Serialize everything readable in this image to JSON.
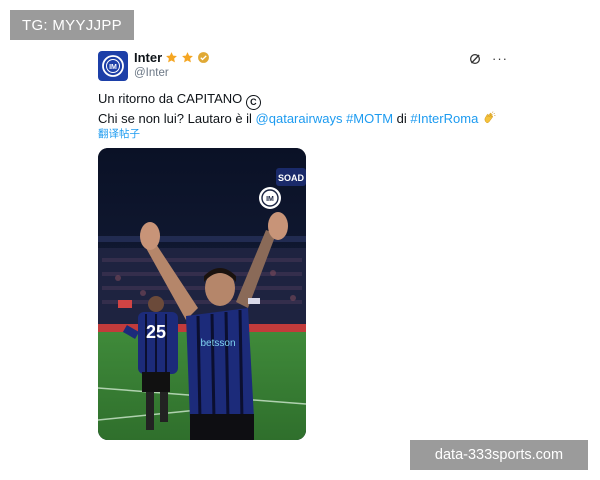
{
  "watermarks": {
    "top_left": "TG: MYYJJPP",
    "bottom_right": "data-333sports.com"
  },
  "tweet": {
    "author": {
      "name": "Inter",
      "handle": "@Inter",
      "avatar_icon": "inter-logo-icon",
      "badges": [
        "star-icon",
        "star-icon",
        "verified-badge-icon"
      ]
    },
    "actions": {
      "grok_icon": "grok-icon",
      "more_label": "···"
    },
    "text": {
      "line1": "Un ritorno da CAPITANO",
      "line1_symbol": "C",
      "line2_prefix": "Chi se non lui? Lautaro è il ",
      "mention": "@qatarairways",
      "hashtag_motm": "#MOTM",
      "connector": " di ",
      "hashtag_match": "#InterRoma",
      "clap_icon": "clapping-hands-icon"
    },
    "translate_link": "翻译帖子",
    "media": {
      "overlay_text": "SOAD",
      "jersey_sponsor": "betsson",
      "teammate_number": "25"
    }
  },
  "colors": {
    "link": "#1d9bf0",
    "inter_blue": "#1c3fa8",
    "star": "#f5a623",
    "verified": "#e0a935",
    "watermark_bg": "#9b9b9b"
  }
}
